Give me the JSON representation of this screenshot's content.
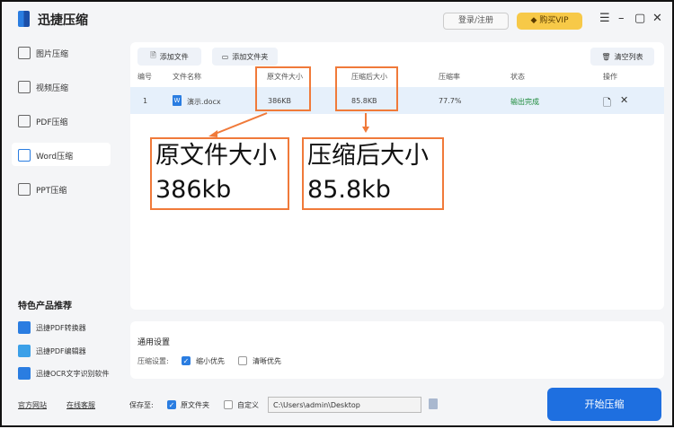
{
  "app": {
    "title": "迅捷压缩",
    "login": "登录/注册",
    "vip": "购买VIP"
  },
  "sidebar": {
    "items": [
      {
        "label": "图片压缩"
      },
      {
        "label": "视频压缩"
      },
      {
        "label": "PDF压缩"
      },
      {
        "label": "Word压缩"
      },
      {
        "label": "PPT压缩"
      }
    ],
    "featured_title": "特色产品推荐",
    "featured": [
      {
        "label": "迅捷PDF转换器"
      },
      {
        "label": "迅捷PDF编辑器"
      },
      {
        "label": "迅捷OCR文字识别软件"
      }
    ],
    "links": {
      "website": "官方网站",
      "support": "在线客服"
    }
  },
  "toolbar": {
    "add_file": "添加文件",
    "add_folder": "添加文件夹",
    "clear": "清空列表"
  },
  "table": {
    "headers": [
      "编号",
      "文件名称",
      "原文件大小",
      "压缩后大小",
      "压缩率",
      "状态",
      "操作"
    ],
    "rows": [
      {
        "index": "1",
        "name": "演示.docx",
        "original": "386KB",
        "compressed": "85.8KB",
        "ratio": "77.7%",
        "status": "输出完成"
      }
    ]
  },
  "annotations": {
    "original_title": "原文件大小",
    "original_value": "386kb",
    "compressed_title": "压缩后大小",
    "compressed_value": "85.8kb"
  },
  "settings": {
    "title": "通用设置",
    "label": "压缩设置:",
    "opt1": "缩小优先",
    "opt2": "清晰优先"
  },
  "footer": {
    "save_label": "保存至:",
    "opt_source": "原文件夹",
    "opt_custom": "自定义",
    "path": "C:\\Users\\admin\\Desktop",
    "start": "开始压缩"
  }
}
